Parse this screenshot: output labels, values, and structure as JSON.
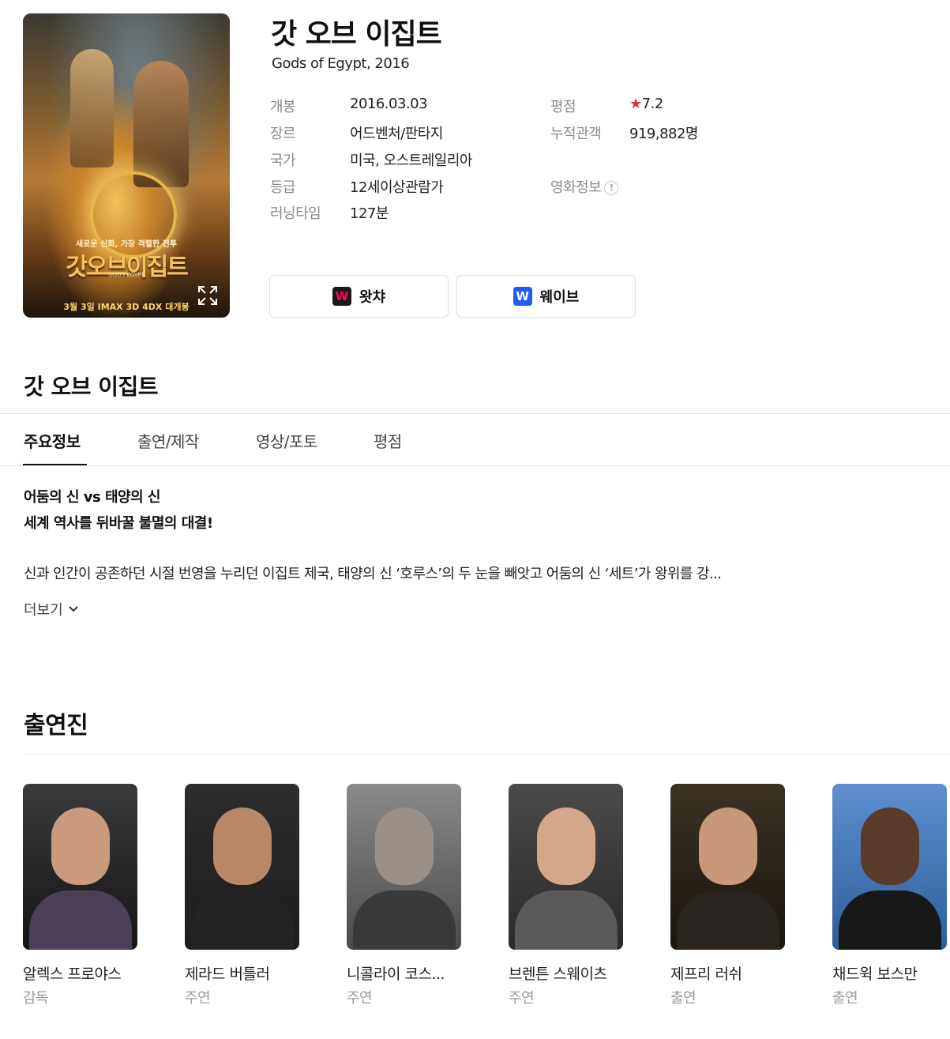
{
  "movie": {
    "title": "갓 오브 이집트",
    "subtitle": "Gods of Egypt, 2016",
    "poster": {
      "tagline": "새로운 신화, 가장 격렬한 전투",
      "title": "갓오브이집트",
      "subtitle": "GODS·EGYPT",
      "bottom": "3월 3일 IMAX 3D 4DX 대개봉"
    }
  },
  "info": {
    "release_label": "개봉",
    "release_value": "2016.03.03",
    "genre_label": "장르",
    "genre_value": "어드벤처/판타지",
    "country_label": "국가",
    "country_value": "미국, 오스트레일리아",
    "rating_label": "등급",
    "rating_value": "12세이상관람가",
    "runtime_label": "러닝타임",
    "runtime_value": "127분",
    "score_label": "평점",
    "score_star": "★",
    "score_value": "7.2",
    "audience_label": "누적관객",
    "audience_value": "919,882명",
    "movieinfo_label": "영화정보",
    "movieinfo_icon": "!"
  },
  "ott": [
    {
      "label": "왓챠",
      "logo_letter": "W",
      "logo_color": "#ff0558",
      "logo_bg": "#1a1a1a"
    },
    {
      "label": "웨이브",
      "logo_letter": "W",
      "logo_color": "#ffffff",
      "logo_bg": "#1f5cf0"
    }
  ],
  "section": {
    "title": "갓 오브 이집트"
  },
  "tabs": [
    {
      "label": "주요정보",
      "active": true
    },
    {
      "label": "출연/제작",
      "active": false
    },
    {
      "label": "영상/포토",
      "active": false
    },
    {
      "label": "평점",
      "active": false
    }
  ],
  "synopsis": {
    "tagline_line1": "어둠의 신 vs 태양의 신",
    "tagline_line2": "세계 역사를 뒤바꿀 불멸의 대결!",
    "text": "신과 인간이 공존하던 시절 번영을 누리던 이집트 제국, 태양의 신 ‘호루스’의 두 눈을 빼앗고 어둠의 신 ‘세트’가 왕위를 강...",
    "more_label": "더보기"
  },
  "cast": {
    "title": "출연진",
    "members": [
      {
        "name": "알렉스 프로야스",
        "role": "감독"
      },
      {
        "name": "제라드 버틀러",
        "role": "주연"
      },
      {
        "name": "니콜라이 코스...",
        "role": "주연"
      },
      {
        "name": "브렌튼 스웨이츠",
        "role": "주연"
      },
      {
        "name": "제프리 러쉬",
        "role": "출연"
      },
      {
        "name": "채드윅 보스만",
        "role": "출연"
      }
    ]
  },
  "colors": {
    "accent_star": "#f0292e",
    "tab_active": "#111111",
    "muted_label": "#8a8a8a"
  }
}
